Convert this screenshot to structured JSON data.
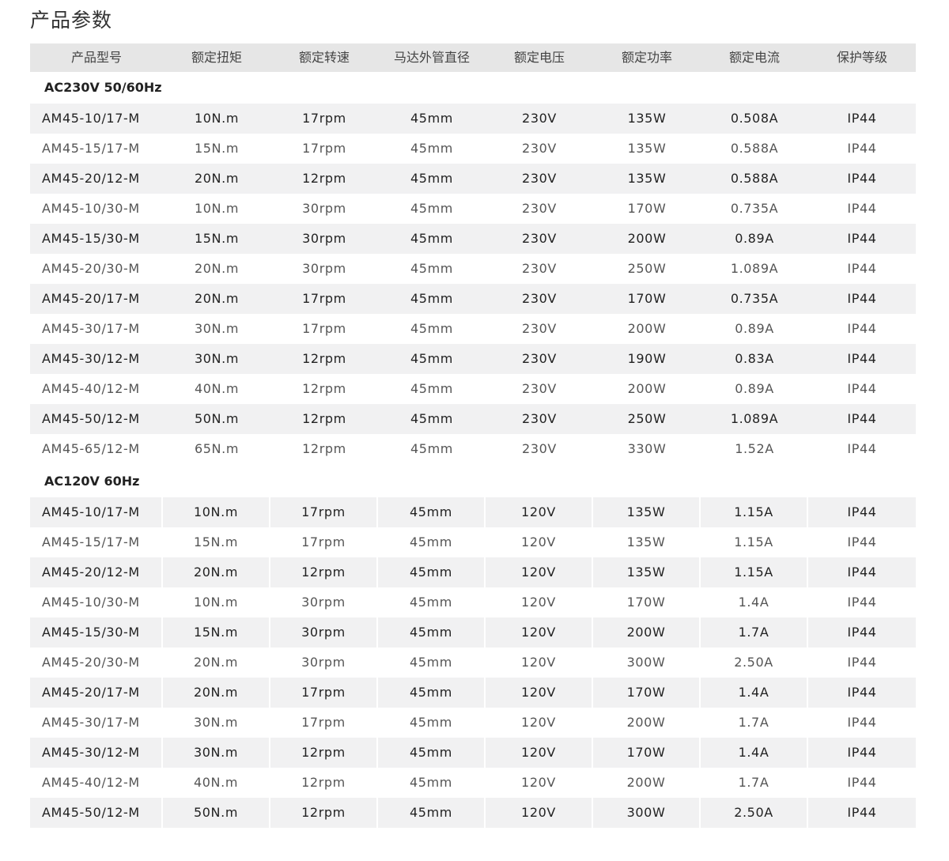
{
  "page_title": "产品参数",
  "table": {
    "headers": [
      "产品型号",
      "额定扭矩",
      "额定转速",
      "马达外管直径",
      "额定电压",
      "额定功率",
      "额定电流",
      "保护等级"
    ],
    "sections": [
      {
        "label": "AC230V 50/60Hz",
        "rows": [
          [
            "AM45-10/17-M",
            "10N.m",
            "17rpm",
            "45mm",
            "230V",
            "135W",
            "0.508A",
            "IP44"
          ],
          [
            "AM45-15/17-M",
            "15N.m",
            "17rpm",
            "45mm",
            "230V",
            "135W",
            "0.588A",
            "IP44"
          ],
          [
            "AM45-20/12-M",
            "20N.m",
            "12rpm",
            "45mm",
            "230V",
            "135W",
            "0.588A",
            "IP44"
          ],
          [
            "AM45-10/30-M",
            "10N.m",
            "30rpm",
            "45mm",
            "230V",
            "170W",
            "0.735A",
            "IP44"
          ],
          [
            "AM45-15/30-M",
            "15N.m",
            "30rpm",
            "45mm",
            "230V",
            "200W",
            "0.89A",
            "IP44"
          ],
          [
            "AM45-20/30-M",
            "20N.m",
            "30rpm",
            "45mm",
            "230V",
            "250W",
            "1.089A",
            "IP44"
          ],
          [
            "AM45-20/17-M",
            "20N.m",
            "17rpm",
            "45mm",
            "230V",
            "170W",
            "0.735A",
            "IP44"
          ],
          [
            "AM45-30/17-M",
            "30N.m",
            "17rpm",
            "45mm",
            "230V",
            "200W",
            "0.89A",
            "IP44"
          ],
          [
            "AM45-30/12-M",
            "30N.m",
            "12rpm",
            "45mm",
            "230V",
            "190W",
            "0.83A",
            "IP44"
          ],
          [
            "AM45-40/12-M",
            "40N.m",
            "12rpm",
            "45mm",
            "230V",
            "200W",
            "0.89A",
            "IP44"
          ],
          [
            "AM45-50/12-M",
            "50N.m",
            "12rpm",
            "45mm",
            "230V",
            "250W",
            "1.089A",
            "IP44"
          ],
          [
            "AM45-65/12-M",
            "65N.m",
            "12rpm",
            "45mm",
            "230V",
            "330W",
            "1.52A",
            "IP44"
          ]
        ]
      },
      {
        "label": "AC120V  60Hz",
        "rows": [
          [
            "AM45-10/17-M",
            "10N.m",
            "17rpm",
            "45mm",
            "120V",
            "135W",
            "1.15A",
            "IP44"
          ],
          [
            "AM45-15/17-M",
            "15N.m",
            "17rpm",
            "45mm",
            "120V",
            "135W",
            "1.15A",
            "IP44"
          ],
          [
            "AM45-20/12-M",
            "20N.m",
            "12rpm",
            "45mm",
            "120V",
            "135W",
            "1.15A",
            "IP44"
          ],
          [
            "AM45-10/30-M",
            "10N.m",
            "30rpm",
            "45mm",
            "120V",
            "170W",
            "1.4A",
            "IP44"
          ],
          [
            "AM45-15/30-M",
            "15N.m",
            "30rpm",
            "45mm",
            "120V",
            "200W",
            "1.7A",
            "IP44"
          ],
          [
            "AM45-20/30-M",
            "20N.m",
            "30rpm",
            "45mm",
            "120V",
            "300W",
            "2.50A",
            "IP44"
          ],
          [
            "AM45-20/17-M",
            "20N.m",
            "17rpm",
            "45mm",
            "120V",
            "170W",
            "1.4A",
            "IP44"
          ],
          [
            "AM45-30/17-M",
            "30N.m",
            "17rpm",
            "45mm",
            "120V",
            "200W",
            "1.7A",
            "IP44"
          ],
          [
            "AM45-30/12-M",
            "30N.m",
            "12rpm",
            "45mm",
            "120V",
            "170W",
            "1.4A",
            "IP44"
          ],
          [
            "AM45-40/12-M",
            "40N.m",
            "12rpm",
            "45mm",
            "120V",
            "200W",
            "1.7A",
            "IP44"
          ],
          [
            "AM45-50/12-M",
            "50N.m",
            "12rpm",
            "45mm",
            "120V",
            "300W",
            "2.50A",
            "IP44"
          ]
        ]
      }
    ]
  },
  "colors": {
    "header_bg": "#e6e6e6",
    "stripe_bg": "#f1f1f2",
    "text": "#333333"
  }
}
